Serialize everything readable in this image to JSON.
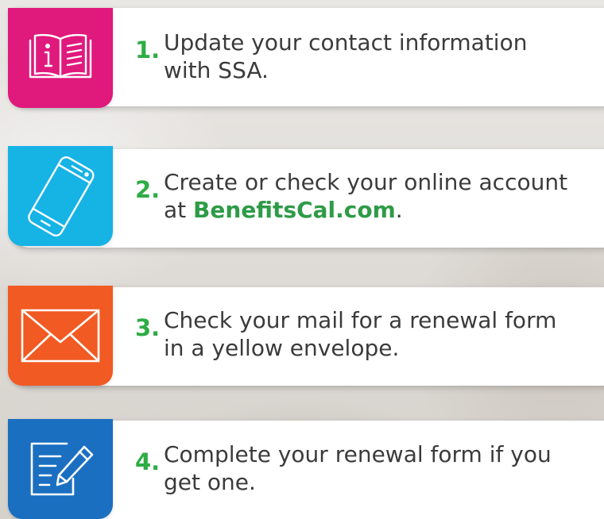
{
  "steps": [
    {
      "number": "1.",
      "text": "Update your contact information with SSA.",
      "icon": "book-info-icon",
      "color": "#e0197d"
    },
    {
      "number": "2.",
      "text_before": "Create or check your online account at ",
      "link": "BenefitsCal.com",
      "text_after": ".",
      "icon": "smartphone-icon",
      "color": "#16b3e5"
    },
    {
      "number": "3.",
      "text": "Check your mail for a renewal form in a yellow envelope.",
      "icon": "envelope-icon",
      "color": "#f15a22"
    },
    {
      "number": "4.",
      "text": "Complete your renewal form if you get one.",
      "icon": "pen-document-icon",
      "color": "#1b6fc1"
    }
  ],
  "colors": {
    "step_number": "#2eac45",
    "link": "#2e9b47",
    "text": "#3b3b3b"
  }
}
